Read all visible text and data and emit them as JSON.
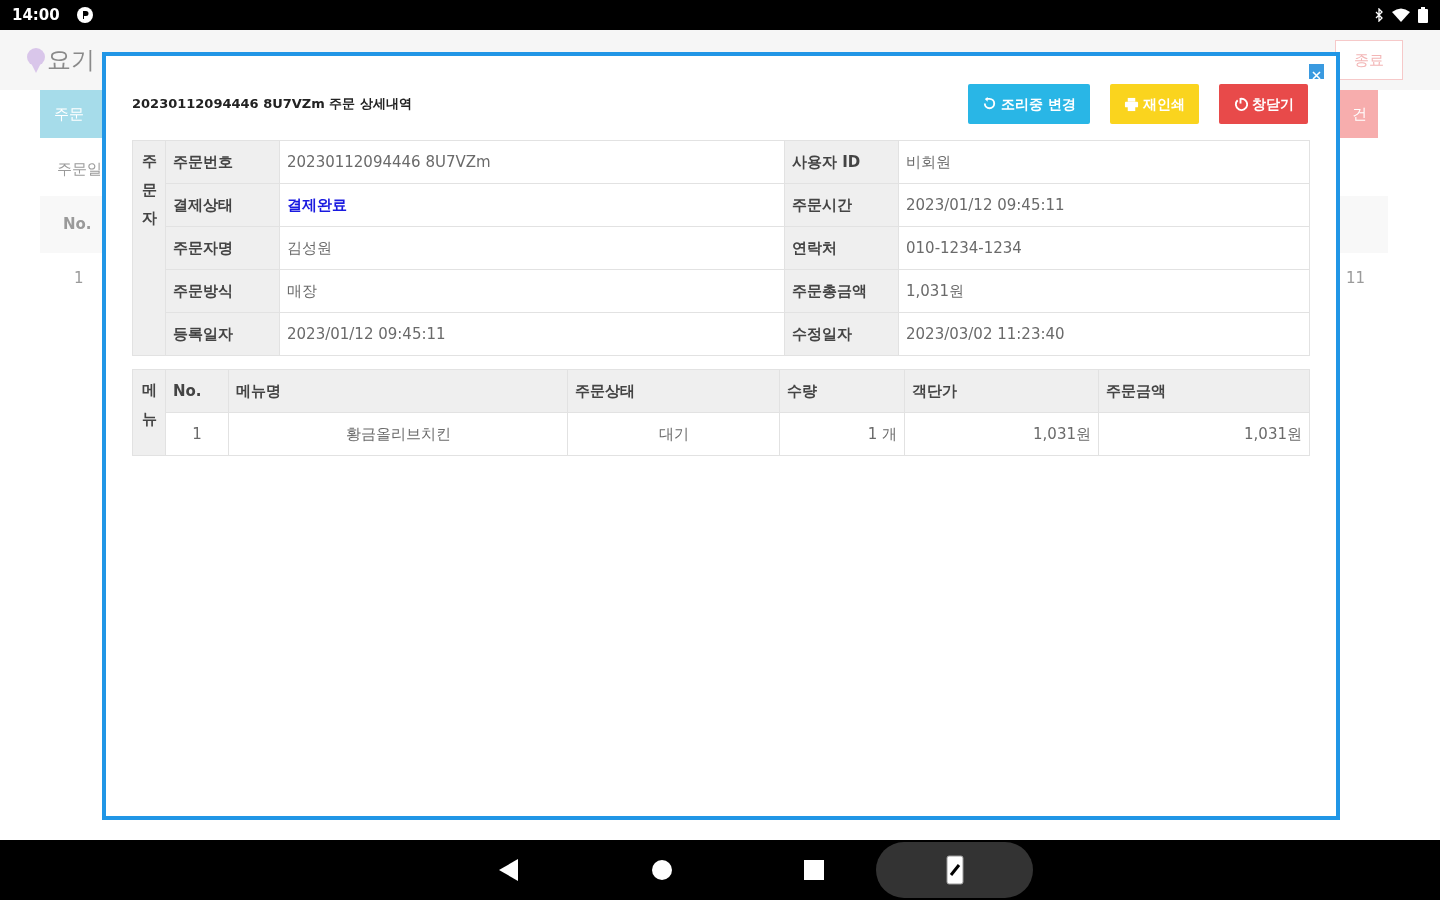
{
  "status_bar": {
    "time": "14:00"
  },
  "background": {
    "logo": "요기",
    "tab": "주문",
    "end_button": "종료",
    "search_button": "건",
    "filter_label": "주문일",
    "column_1": "No.",
    "row_number": "1",
    "row_tail": "11"
  },
  "modal": {
    "title": "20230112094446 8U7VZm 주문 상세내역",
    "buttons": [
      {
        "kind": "refresh",
        "label": "조리중 변경",
        "color": "#29b6e6"
      },
      {
        "kind": "print",
        "label": "재인쇄",
        "color": "#fad41e"
      },
      {
        "kind": "power",
        "label": "창닫기",
        "color": "#e84a4a"
      }
    ],
    "customer_info": {
      "group_label": "주문자",
      "rows": [
        {
          "label": "주문번호",
          "value": "20230112094446 8U7VZm",
          "emphasis": false,
          "label_2": "사용자 ID",
          "value_2": "비회원"
        },
        {
          "label": "결제상태",
          "value": "결제완료",
          "emphasis": true,
          "label_2": "주문시간",
          "value_2": "2023/01/12 09:45:11"
        },
        {
          "label": "주문자명",
          "value": "김성원",
          "emphasis": false,
          "label_2": "연락처",
          "value_2": "010-1234-1234"
        },
        {
          "label": "주문방식",
          "value": "매장",
          "emphasis": false,
          "label_2": "주문총금액",
          "value_2": "1,031원"
        },
        {
          "label": "등록일자",
          "value": "2023/01/12 09:45:11",
          "emphasis": false,
          "label_2": "수정일자",
          "value_2": "2023/03/02 11:23:40"
        }
      ]
    },
    "menu_table": {
      "group_label": "메뉴",
      "columns": [
        "No.",
        "메뉴명",
        "주문상태",
        "수량",
        "객단가",
        "주문금액"
      ],
      "rows": [
        [
          "1",
          "황금올리브치킨",
          "대기",
          "1 개",
          "1,031원",
          "1,031원"
        ]
      ]
    }
  }
}
